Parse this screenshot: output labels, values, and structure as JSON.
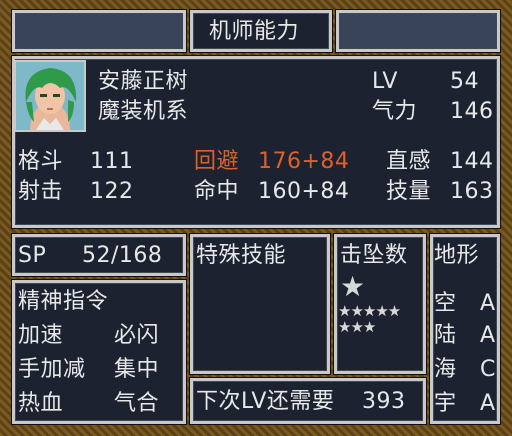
{
  "header": {
    "title": "机师能力"
  },
  "pilot": {
    "name": "安藤正树",
    "group": "魔装机系",
    "lv_label": "LV",
    "lv": "54",
    "will_label": "气力",
    "will": "146"
  },
  "stats": {
    "melee_label": "格斗",
    "melee": "111",
    "shoot_label": "射击",
    "shoot": "122",
    "evade_label": "回避",
    "evade": "176+84",
    "hit_label": "命中",
    "hit": "160+84",
    "intuition_label": "直感",
    "intuition": "144",
    "skill_label": "技量",
    "skill": "163"
  },
  "sp": {
    "label": "SP",
    "value": "52/168"
  },
  "spirit": {
    "title": "精神指令",
    "items": [
      "加速",
      "必闪",
      "手加减",
      "集中",
      "热血",
      "气合"
    ]
  },
  "special": {
    "title": "特殊技能"
  },
  "kills": {
    "title": "击坠数",
    "big_stars": 1,
    "small_stars": 8
  },
  "next_level": {
    "label": "下次LV还需要",
    "value": "393"
  },
  "terrain": {
    "title": "地形",
    "rows": [
      {
        "name": "空",
        "rank": "A"
      },
      {
        "name": "陆",
        "rank": "A"
      },
      {
        "name": "海",
        "rank": "C"
      },
      {
        "name": "宇",
        "rank": "A"
      }
    ]
  },
  "colors": {
    "panel": "#1c2230",
    "border": "#c9c9c9",
    "highlight": "#e0602a",
    "frame": "#6b4e1c"
  }
}
